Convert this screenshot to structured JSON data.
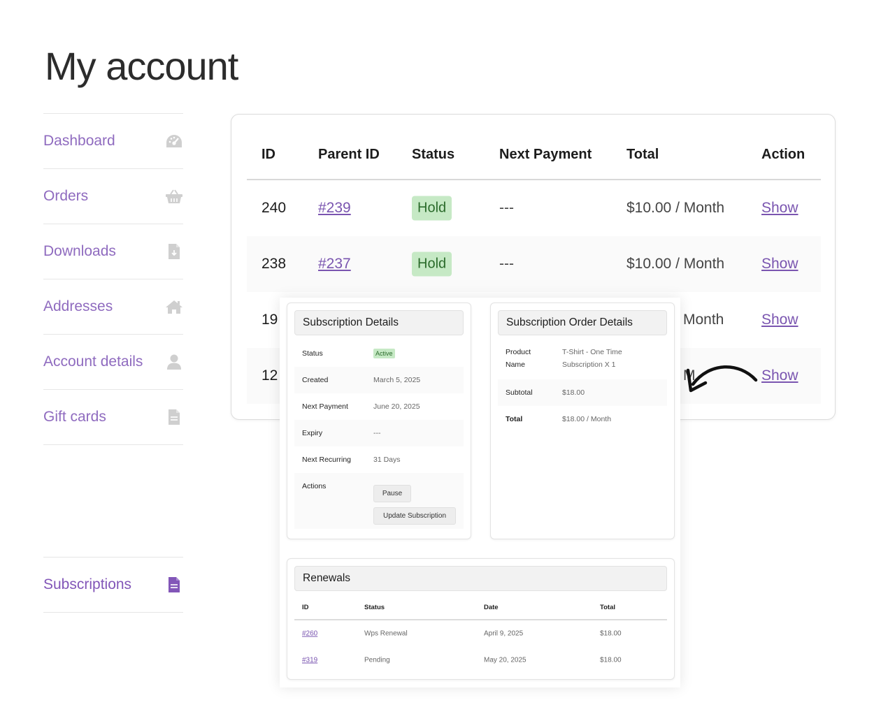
{
  "page": {
    "title": "My account"
  },
  "sidebar": {
    "items": [
      {
        "label": "Dashboard",
        "icon": "dashboard-gauge-icon"
      },
      {
        "label": "Orders",
        "icon": "basket-icon"
      },
      {
        "label": "Downloads",
        "icon": "file-download-icon"
      },
      {
        "label": "Addresses",
        "icon": "home-icon"
      },
      {
        "label": "Account details",
        "icon": "user-icon"
      },
      {
        "label": "Gift cards",
        "icon": "document-icon"
      },
      {
        "label": "Subscriptions",
        "icon": "document-icon"
      }
    ],
    "active": "Subscriptions"
  },
  "table": {
    "headers": {
      "id": "ID",
      "parent_id": "Parent ID",
      "status": "Status",
      "next_payment": "Next Payment",
      "total": "Total",
      "action": "Action"
    },
    "rows": [
      {
        "id": "240",
        "parent_id": "#239",
        "status": "Hold",
        "next_payment": "---",
        "total": "$10.00 / Month",
        "action": "Show"
      },
      {
        "id": "238",
        "parent_id": "#237",
        "status": "Hold",
        "next_payment": "---",
        "total": "$10.00 / Month",
        "action": "Show"
      },
      {
        "id": "19",
        "total_partial": "Month",
        "action": "Show"
      },
      {
        "id": "12",
        "total_partial": "M",
        "action": "Show"
      }
    ]
  },
  "subscription_details": {
    "title": "Subscription Details",
    "status_label": "Status",
    "status_value": "Active",
    "created_label": "Created",
    "created_value": "March 5, 2025",
    "next_payment_label": "Next Payment",
    "next_payment_value": "June 20, 2025",
    "expiry_label": "Expiry",
    "expiry_value": "---",
    "next_recurring_label": "Next Recurring",
    "next_recurring_value": "31 Days",
    "actions_label": "Actions",
    "pause_button": "Pause",
    "update_button": "Update Subscription"
  },
  "order_details": {
    "title": "Subscription Order Details",
    "product_label_line1": "Product",
    "product_label_line2": "Name",
    "product_value_line1": "T-Shirt - One Time",
    "product_value_line2": "Subscription X 1",
    "subtotal_label": "Subtotal",
    "subtotal_value": "$18.00",
    "total_label": "Total",
    "total_value": "$18.00 / Month"
  },
  "renewals": {
    "title": "Renewals",
    "headers": {
      "id": "ID",
      "status": "Status",
      "date": "Date",
      "total": "Total"
    },
    "rows": [
      {
        "id": "#260",
        "status": "Wps Renewal",
        "date": "April 9, 2025",
        "total": "$18.00"
      },
      {
        "id": "#319",
        "status": "Pending",
        "date": "May 20, 2025",
        "total": "$18.00"
      }
    ]
  },
  "colors": {
    "accent": "#7a55b0",
    "nav_text": "#8f6bbf",
    "icon_gray": "#cfcfcf",
    "badge_bg": "#c6e9c5",
    "badge_text": "#2b6b2b"
  }
}
